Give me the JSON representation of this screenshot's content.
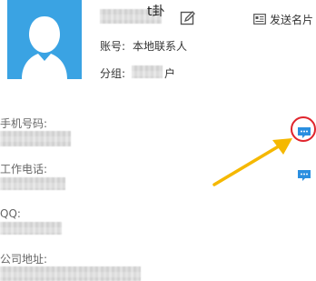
{
  "contact": {
    "name_tail": "t卦",
    "account_label": "账号:",
    "account_value": "本地联系人",
    "group_label": "分组:",
    "group_value_tail": "户"
  },
  "actions": {
    "send_card_label": "发送名片"
  },
  "fields": {
    "phone_label": "手机号码:",
    "work_phone_label": "工作电话:",
    "qq_label": "QQ:",
    "address_label": "公司地址:"
  },
  "colors": {
    "avatar_bg": "#3aa3e3",
    "chat_icon": "#2b8fe0",
    "highlight_circle": "#e0242c",
    "arrow": "#f5b800"
  },
  "icons": {
    "avatar": "person-silhouette-icon",
    "edit": "edit-pencil-icon",
    "send_card": "card-icon",
    "chat": "chat-bubble-icon"
  }
}
